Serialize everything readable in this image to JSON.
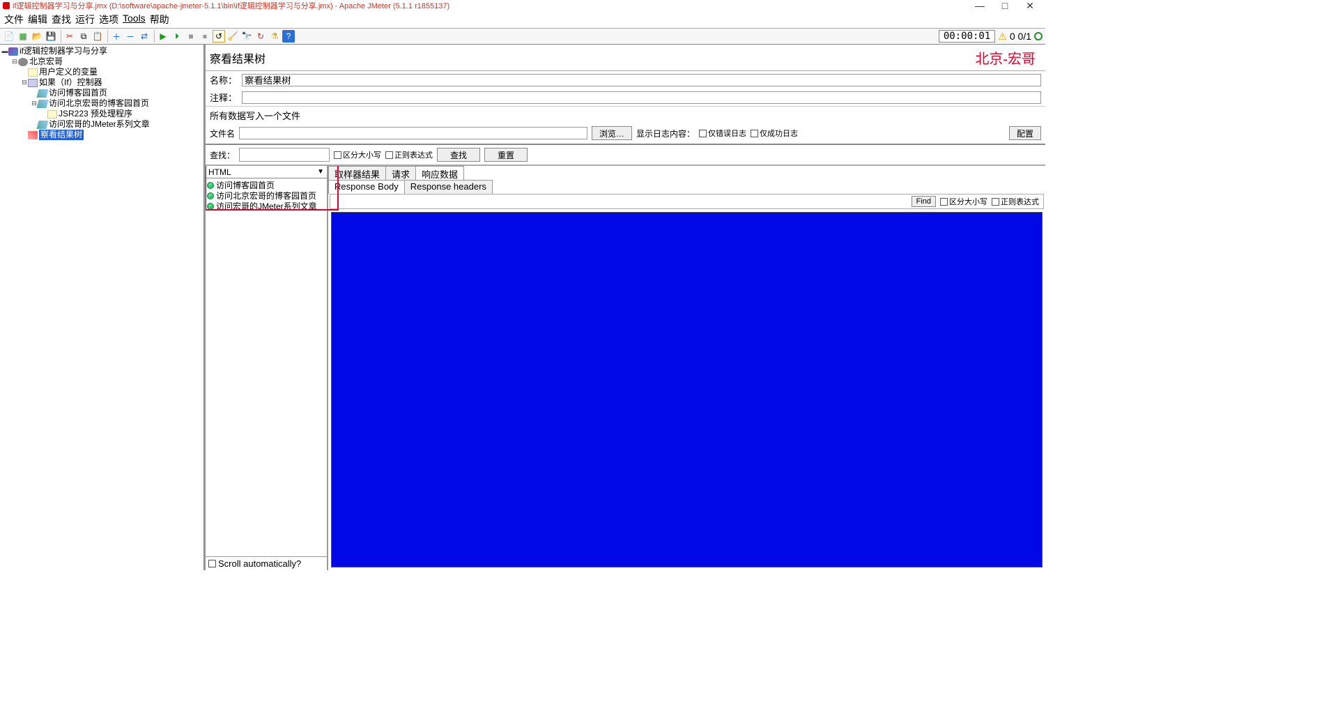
{
  "titlebar": {
    "title": "if逻辑控制器学习与分享.jmx (D:\\software\\apache-jmeter-5.1.1\\bin\\if逻辑控制器学习与分享.jmx) - Apache JMeter (5.1.1 r1855137)"
  },
  "menubar": [
    "文件",
    "编辑",
    "查找",
    "运行",
    "选项",
    "Tools",
    "帮助"
  ],
  "toolbar_status": {
    "timer": "00:00:01",
    "counter": "0 0/1"
  },
  "tree": {
    "root": "if逻辑控制器学习与分享",
    "thread_group": "北京宏哥",
    "items": [
      "用户定义的变量",
      "如果（If）控制器",
      "访问博客园首页",
      "访问北京宏哥的博客园首页",
      "JSR223 预处理程序",
      "访问宏哥的JMeter系列文章",
      "察看结果树"
    ]
  },
  "panel": {
    "title": "察看结果树",
    "name_label": "名称：",
    "name_value": "察看结果树",
    "comment_label": "注释：",
    "comment_value": "",
    "file_section": "所有数据写入一个文件",
    "filename_label": "文件名",
    "browse_btn": "浏览…",
    "log_display_label": "显示日志内容：",
    "chk_error": "仅错误日志",
    "chk_success": "仅成功日志",
    "config_btn": "配置",
    "search_label": "查找：",
    "chk_case": "区分大小写",
    "chk_regex": "正则表达式",
    "search_btn": "查找",
    "reset_btn": "重置",
    "watermark": "北京-宏哥"
  },
  "results": {
    "renderer": "HTML",
    "items": [
      "访问博客园首页",
      "访问北京宏哥的博客园首页",
      "访问宏哥的JMeter系列文章"
    ],
    "scroll_label": "Scroll automatically?"
  },
  "response": {
    "tabs": [
      "取样器结果",
      "请求",
      "响应数据"
    ],
    "subtabs": [
      "Response Body",
      "Response headers"
    ],
    "find_label": "Find",
    "chk_case": "区分大小写",
    "chk_regex": "正则表达式"
  }
}
